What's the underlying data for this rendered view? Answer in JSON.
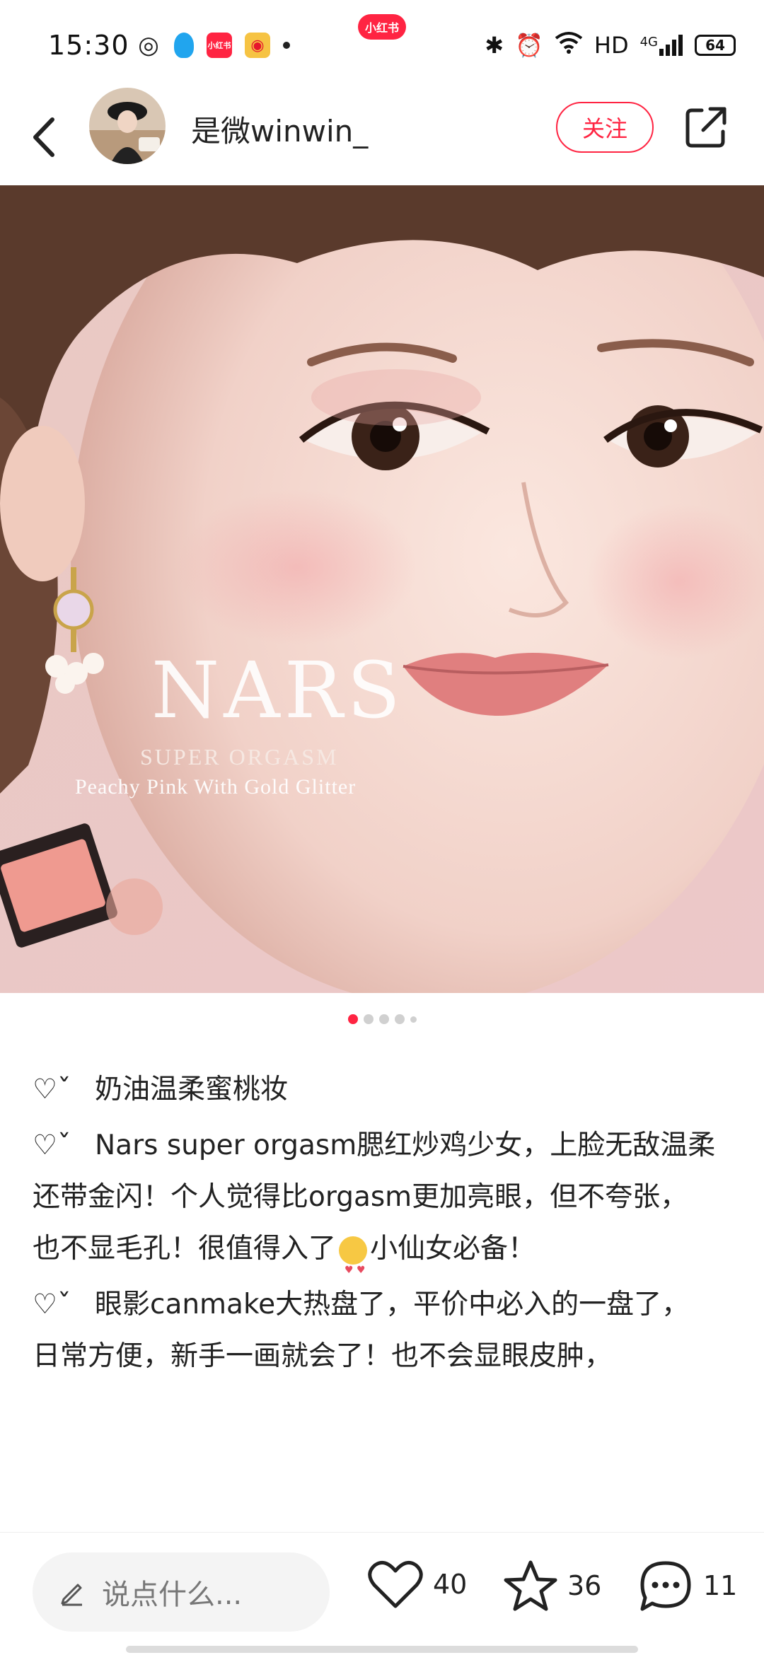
{
  "status_bar": {
    "time": "15:30",
    "app_badge": "小红书",
    "network": "HD",
    "signal": "4G",
    "battery": "64"
  },
  "header": {
    "author_name": "是微winwin_",
    "follow_label": "关注"
  },
  "photo": {
    "brand": "NARS",
    "product": "SUPER ORGASM",
    "shade": "Peachy Pink With Gold Glitter"
  },
  "carousel": {
    "count": 5,
    "active_index": 0
  },
  "caption": {
    "bullet": "♡ˇ",
    "lines": [
      "奶油温柔蜜桃妆",
      "Nars super orgasm腮红炒鸡少女，上脸无敌温柔",
      "还带金闪！个人觉得比orgasm更加亮眼，但不夸张，",
      "也不显毛孔！很值得入了",
      "小仙女必备！",
      "眼影canmake大热盘了，平价中必入的一盘了，",
      "日常方便，新手一画就会了！也不会显眼皮肿，"
    ]
  },
  "bottom_bar": {
    "comment_placeholder": "说点什么...",
    "likes": "40",
    "collects": "36",
    "comments": "11"
  }
}
